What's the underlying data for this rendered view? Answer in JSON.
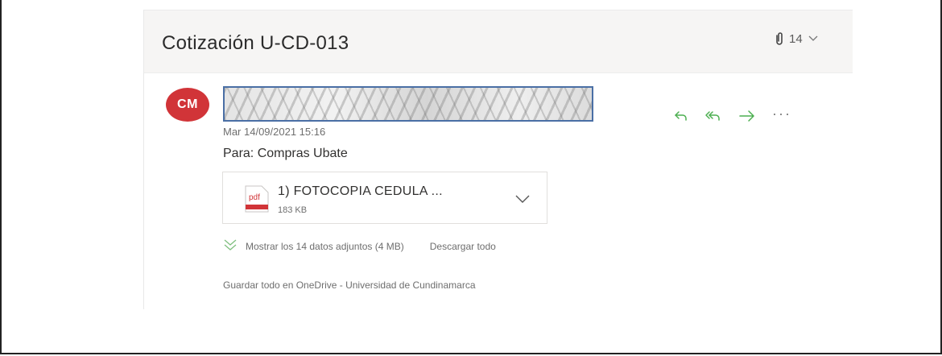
{
  "email": {
    "subject": "Cotización U-CD-013",
    "attachment_count": "14",
    "sender_initials": "CM",
    "date": "Mar 14/09/2021 15:16",
    "to": "Para:  Compras Ubate",
    "attachment": {
      "name": "1) FOTOCOPIA CEDULA ...",
      "size": "183 KB",
      "icon": "pdf-file-icon"
    },
    "show_all_label": "Mostrar los 14 datos adjuntos (4 MB)",
    "download_all_label": "Descargar todo",
    "save_onedrive_label": "Guardar todo en OneDrive - Universidad de Cundinamarca",
    "actions": {
      "more_label": "···",
      "icons": [
        "reply-icon",
        "reply-all-icon",
        "forward-icon",
        "more-icon"
      ]
    }
  },
  "colors": {
    "avatar_bg": "#d13438",
    "action_green": "#4caf50",
    "pdf_red": "#d13438",
    "highlight_border": "#4a6fa5"
  }
}
